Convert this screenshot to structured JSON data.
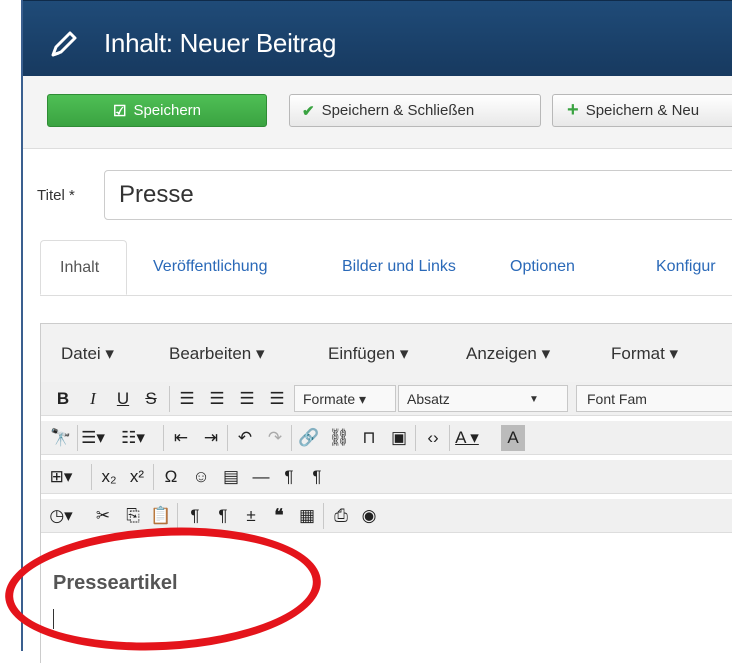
{
  "header": {
    "title": "Inhalt: Neuer Beitrag"
  },
  "toolbar": {
    "save_label": "Speichern",
    "save_close_label": "Speichern & Schließen",
    "save_new_label": "Speichern & Neu"
  },
  "form": {
    "title_label": "Titel *",
    "title_value": "Presse"
  },
  "tabs": [
    {
      "label": "Inhalt"
    },
    {
      "label": "Veröffentlichung"
    },
    {
      "label": "Bilder und Links"
    },
    {
      "label": "Optionen"
    },
    {
      "label": "Konfigur"
    }
  ],
  "editor": {
    "menus": [
      {
        "label": "Datei ▾"
      },
      {
        "label": "Bearbeiten ▾"
      },
      {
        "label": "Einfügen ▾"
      },
      {
        "label": "Anzeigen ▾"
      },
      {
        "label": "Format ▾"
      }
    ],
    "formats_label": "Formate ▾",
    "block_label": "Absatz",
    "font_family_label": "Font Fam",
    "content_heading": "Presseartikel"
  },
  "colors": {
    "header_bg": "#1f4b78",
    "save_green": "#3aa341",
    "link_blue": "#2a69b8",
    "annotation_red": "#e4141b"
  }
}
